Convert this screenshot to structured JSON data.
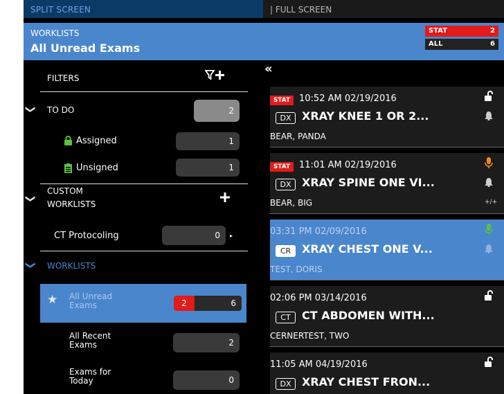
{
  "topbar": {
    "split_label": "SPLIT SCREEN",
    "full_label": "| FULL SCREEN"
  },
  "header": {
    "subtitle": "WORKLISTS",
    "title": "All Unread Exams",
    "counts": [
      {
        "label": "STAT",
        "value": "2"
      },
      {
        "label": "ALL",
        "value": "6"
      }
    ]
  },
  "filters": {
    "label": "FILTERS",
    "icon": "filter-add-icon"
  },
  "todo": {
    "label": "TO DO",
    "count": "2",
    "items": [
      {
        "label": "Assigned",
        "count": "1",
        "icon": "lock-icon"
      },
      {
        "label": "Unsigned",
        "count": "1",
        "icon": "clipboard-icon"
      }
    ]
  },
  "custom_worklists": {
    "line1": "CUSTOM",
    "line2": "WORKLISTS",
    "add_icon": "plus-icon",
    "items": [
      {
        "label": "CT Protocoling",
        "count": "0"
      }
    ]
  },
  "worklists": {
    "label": "WORKLISTS",
    "items": [
      {
        "line1": "All Unread",
        "line2": "Exams",
        "stat": "2",
        "count": "6"
      },
      {
        "line1": "All Recent",
        "line2": "Exams",
        "count": "2"
      },
      {
        "line1": "Exams for",
        "line2": "Today",
        "count": "0"
      }
    ]
  },
  "exams": [
    {
      "stat": "STAT",
      "time": "10:52 AM 02/19/2016",
      "modality": "DX",
      "description": "XRAY KNEE 1 OR 2...",
      "patient": "BEAR, PANDA"
    },
    {
      "stat": "STAT",
      "time": "11:01 AM 02/19/2016",
      "modality": "DX",
      "description": "XRAY SPINE ONE VI...",
      "patient": "BEAR, BIG",
      "extra": "+/+"
    },
    {
      "time": "03:31 PM 02/09/2016",
      "modality": "CR",
      "description": "XRAY CHEST ONE V...",
      "patient": "TEST, DORIS"
    },
    {
      "time": "02:06 PM 03/14/2016",
      "modality": "CT",
      "description": "CT ABDOMEN WITH...",
      "patient": "CERNERTEST, TWO"
    },
    {
      "time": "11:05 AM 04/19/2016",
      "modality": "DX",
      "description": "XRAY CHEST FRON..."
    }
  ],
  "colors": {
    "accent": "#4a86cc",
    "stat": "#e21b1b",
    "lock_green": "#5cc13c",
    "mic_orange": "#f08a1c",
    "mic_green": "#5cc13c"
  }
}
